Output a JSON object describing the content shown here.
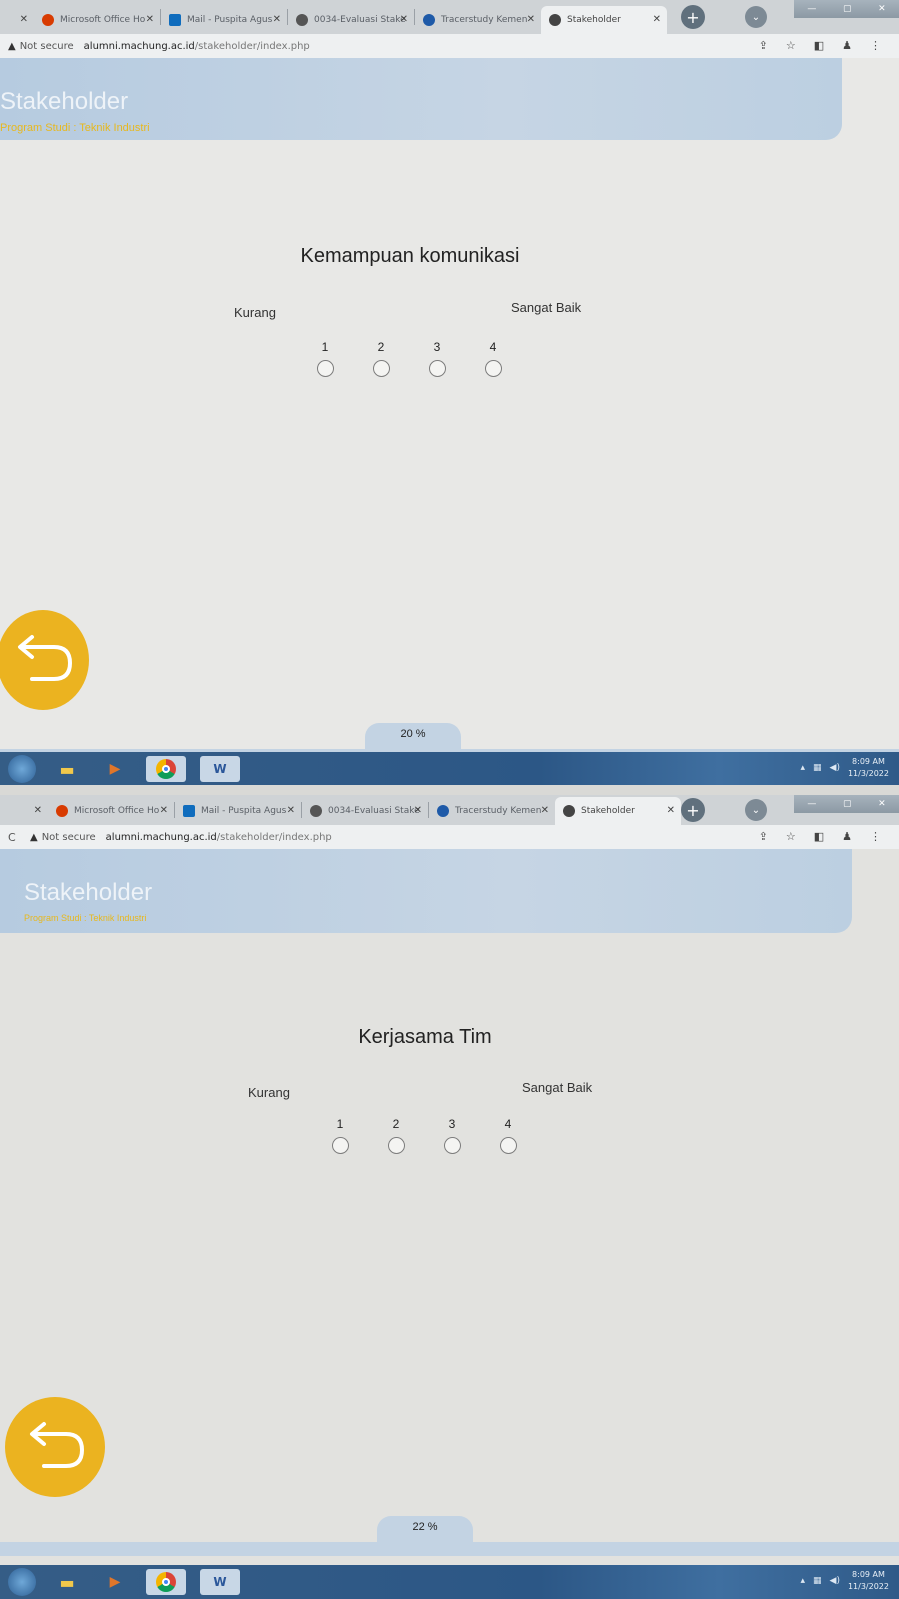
{
  "screens": [
    {
      "tabs": [
        "",
        "Microsoft Office Ho",
        "Mail - Puspita Agus",
        "0034-Evaluasi Stake",
        "Tracerstudy Kemen",
        "Stakeholder"
      ],
      "address": {
        "not_secure": "Not secure",
        "host": "alumni.machung.ac.id",
        "path": "/stakeholder/index.php"
      },
      "header": {
        "title": "Stakeholder",
        "subtitle": "Program Studi : Teknik Industri"
      },
      "question": {
        "title": "Kemampuan komunikasi",
        "scale_low": "Kurang",
        "scale_high": "Sangat Baik",
        "options": [
          "1",
          "2",
          "3",
          "4"
        ]
      },
      "progress": {
        "label": "20 %",
        "value": 20
      },
      "taskbar": {
        "word": "W",
        "time": "8:09 AM",
        "date": "11/3/2022"
      }
    },
    {
      "tabs": [
        "",
        "Microsoft Office Ho",
        "Mail - Puspita Agus",
        "0034-Evaluasi Stake",
        "Tracerstudy Kemen",
        "Stakeholder"
      ],
      "address": {
        "not_secure": "Not secure",
        "host": "alumni.machung.ac.id",
        "path": "/stakeholder/index.php"
      },
      "header": {
        "title": "Stakeholder",
        "subtitle": "Program Studi : Teknik Industri"
      },
      "question": {
        "title": "Kerjasama Tim",
        "scale_low": "Kurang",
        "scale_high": "Sangat Baik",
        "options": [
          "1",
          "2",
          "3",
          "4"
        ]
      },
      "progress": {
        "label": "22 %",
        "value": 22
      },
      "taskbar": {
        "word": "W",
        "time": "8:09 AM",
        "date": "11/3/2022"
      }
    }
  ],
  "colors": {
    "banner": "#bccfe1",
    "subtitle": "#e7b81e",
    "back_button": "#ebb320",
    "taskbar": "#2c5786"
  },
  "icons": {
    "back": "undo-arrow-icon",
    "new_tab": "plus-icon",
    "warning": "warning-triangle-icon"
  }
}
